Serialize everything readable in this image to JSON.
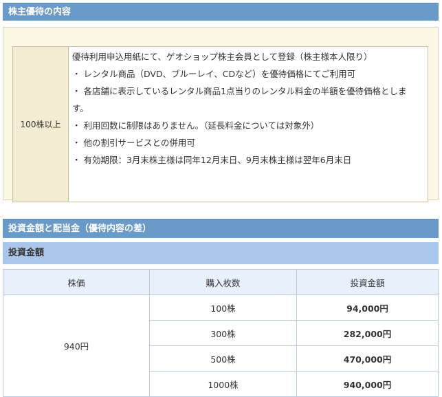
{
  "section1": {
    "title": "株主優待の内容"
  },
  "benefit": {
    "condition": "100株以上",
    "lines": [
      "優待利用申込用紙にて、ゲオショップ株主会員として登録（株主様本人限り）",
      "・ レンタル商品（DVD、ブルーレイ、CDなど）を優待価格にてご利用可",
      "・ 各店舗に表示しているレンタル商品1点当りのレンタル料金の半額を優待価格としま",
      "す。",
      "・ 利用回数に制限はありません。（延長料金については対象外）",
      "・ 他の割引サービスとの併用可",
      "・ 有効期限：3月末株主様は同年12月末日、9月末株主様は翌年6月末日"
    ]
  },
  "section2": {
    "title": "投資金額と配当金（優待内容の差）"
  },
  "subsection": {
    "title": "投資金額"
  },
  "invest": {
    "headers": [
      "株価",
      "購入枚数",
      "投資金額"
    ],
    "price": "940円",
    "rows": [
      {
        "shares": "100株",
        "amount": "94,000円"
      },
      {
        "shares": "300株",
        "amount": "282,000円"
      },
      {
        "shares": "500株",
        "amount": "470,000円"
      },
      {
        "shares": "1000株",
        "amount": "940,000円"
      }
    ]
  }
}
